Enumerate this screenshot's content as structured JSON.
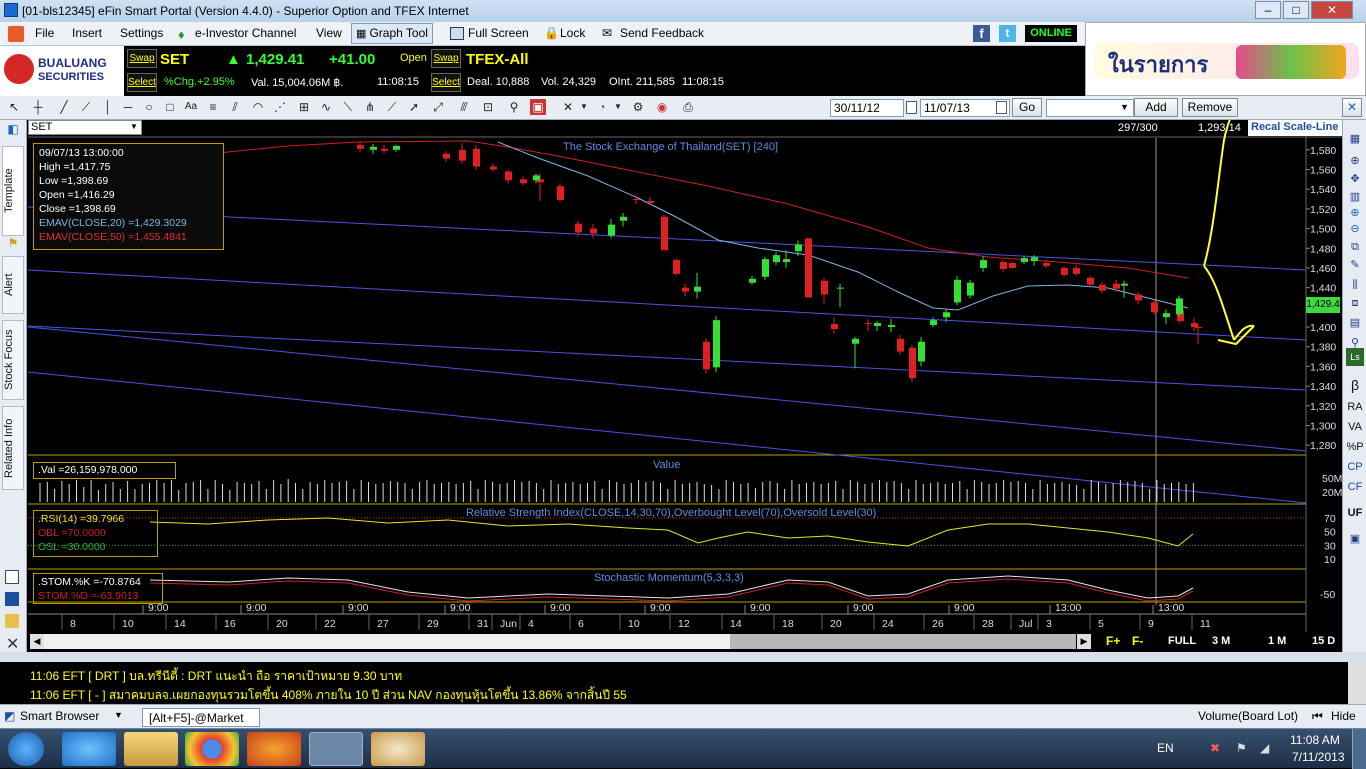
{
  "window": {
    "title": "[01-bls12345] eFin Smart Portal (Version 4.4.0) - Superior Option and TFEX Internet"
  },
  "menu": {
    "items": [
      "File",
      "Insert",
      "Settings",
      "e-Investor Channel",
      "View",
      "Graph Tool",
      "Full Screen",
      "Lock",
      "Send Feedback"
    ],
    "online": "ONLINE"
  },
  "logo": {
    "name1": "BUALUANG",
    "name2": "SECURITIES"
  },
  "quote": {
    "swap": "Swap",
    "select": "Select",
    "set_label": "SET",
    "set_price": "1,429.41",
    "set_change": "+41.00",
    "set_status": "Open",
    "set_pct": "%Chg.+2.95%",
    "set_val": "Val. 15,004.06M ฿.",
    "set_time": "11:08:15",
    "tfex_label": "TFEX-All",
    "tfex_deal": "Deal. 10,888",
    "tfex_vol": "Vol. 24,329",
    "tfex_oint": "OInt. 211,585",
    "tfex_time": "11:08:15"
  },
  "ad": {
    "text": "ในรายการ"
  },
  "drawbar": {
    "date_from": "30/11/12",
    "date_to": "11/07/13",
    "go": "Go",
    "add": "Add",
    "remove": "Remove"
  },
  "lefttabs": [
    "Template",
    "Alert",
    "Stock Focus",
    "Related Info"
  ],
  "chart": {
    "symbol": "SET",
    "title": "The Stock Exchange of Thailand(SET) [240]",
    "counter": "297/300",
    "cursor_value": "1,293.14",
    "recal": "Recal Scale-Line",
    "current_price_label": "1,429.4",
    "info": {
      "date": "09/07/13 13:00:00",
      "high": "High  =1,417.75",
      "low": "Low  =1,398.69",
      "open": "Open  =1,416.29",
      "close": "Close  =1,398.69",
      "ema20": "EMAV(CLOSE,20)  =1,429.3029",
      "ema50": "EMAV(CLOSE,50)  =1,455.4841"
    },
    "val_box": ".Val  =26,159,978.000",
    "value_title": "Value",
    "rsi_title": "Relative Strength Index(CLOSE,14,30,70),Overbought Level(70),Oversold Level(30)",
    "rsi_box": {
      "rsi": ".RSI(14)  =39.7966",
      "obl": "OBL  =70.0000",
      "osl": "OSL  =30.0000"
    },
    "stoch_title": "Stochastic Momentum(5,3,3,3)",
    "stoch_box": {
      "k": ".STOM.%K  =-70.8764",
      "d": "STOM.%D  =-63.9013"
    },
    "time_ticks": [
      "9:00",
      "9:00",
      "9:00",
      "9:00",
      "9:00",
      "9:00",
      "9:00",
      "9:00",
      "9:00",
      "13:00",
      "13:00"
    ],
    "date_ticks": [
      "8",
      "10",
      "14",
      "16",
      "20",
      "22",
      "27",
      "29",
      "31",
      "Jun",
      "4",
      "6",
      "10",
      "12",
      "14",
      "18",
      "20",
      "24",
      "26",
      "28",
      "Jul",
      "3",
      "5",
      "9",
      "11"
    ],
    "price_axis": [
      "1,580",
      "1,560",
      "1,540",
      "1,520",
      "1,500",
      "1,480",
      "1,460",
      "1,440",
      "1,420",
      "1,400",
      "1,380",
      "1,360",
      "1,340",
      "1,320",
      "1,300",
      "1,280"
    ],
    "value_axis": [
      "50M",
      "20M"
    ],
    "rsi_axis": [
      "70",
      "50",
      "30",
      "10"
    ],
    "stoch_axis": [
      "-50"
    ],
    "candles": [
      {
        "o": 1585,
        "h": 1588,
        "l": 1578,
        "c": 1581
      },
      {
        "o": 1580,
        "h": 1586,
        "l": 1576,
        "c": 1583
      },
      {
        "o": 1581,
        "h": 1585,
        "l": 1576,
        "c": 1579
      },
      {
        "o": 1580,
        "h": 1585,
        "l": 1578,
        "c": 1584
      },
      {
        "o": 1576,
        "h": 1579,
        "l": 1568,
        "c": 1571
      },
      {
        "o": 1580,
        "h": 1587,
        "l": 1566,
        "c": 1569
      },
      {
        "o": 1581,
        "h": 1585,
        "l": 1560,
        "c": 1563
      },
      {
        "o": 1563,
        "h": 1566,
        "l": 1558,
        "c": 1560
      },
      {
        "o": 1558,
        "h": 1560,
        "l": 1546,
        "c": 1549
      },
      {
        "o": 1550,
        "h": 1553,
        "l": 1544,
        "c": 1546
      },
      {
        "o": 1550,
        "h": 1556,
        "l": 1528,
        "c": 1547
      },
      {
        "o": 1549,
        "h": 1556,
        "l": 1546,
        "c": 1554
      },
      {
        "o": 1543,
        "h": 1546,
        "l": 1527,
        "c": 1529
      },
      {
        "o": 1505,
        "h": 1508,
        "l": 1492,
        "c": 1496
      },
      {
        "o": 1500,
        "h": 1505,
        "l": 1490,
        "c": 1495
      },
      {
        "o": 1493,
        "h": 1510,
        "l": 1490,
        "c": 1504
      },
      {
        "o": 1508,
        "h": 1516,
        "l": 1502,
        "c": 1512
      },
      {
        "o": 1530,
        "h": 1534,
        "l": 1525,
        "c": 1529
      },
      {
        "o": 1528,
        "h": 1532,
        "l": 1524,
        "c": 1526
      },
      {
        "o": 1512,
        "h": 1514,
        "l": 1490,
        "c": 1478
      },
      {
        "o": 1468,
        "h": 1470,
        "l": 1452,
        "c": 1454
      },
      {
        "o": 1440,
        "h": 1444,
        "l": 1431,
        "c": 1436
      },
      {
        "o": 1436,
        "h": 1455,
        "l": 1429,
        "c": 1441
      },
      {
        "o": 1385,
        "h": 1388,
        "l": 1353,
        "c": 1357
      },
      {
        "o": 1359,
        "h": 1411,
        "l": 1354,
        "c": 1407
      },
      {
        "o": 1445,
        "h": 1452,
        "l": 1443,
        "c": 1449
      },
      {
        "o": 1451,
        "h": 1471,
        "l": 1448,
        "c": 1469
      },
      {
        "o": 1466,
        "h": 1476,
        "l": 1463,
        "c": 1473
      },
      {
        "o": 1466,
        "h": 1478,
        "l": 1460,
        "c": 1469
      },
      {
        "o": 1477,
        "h": 1488,
        "l": 1472,
        "c": 1484
      },
      {
        "o": 1490,
        "h": 1491,
        "l": 1470,
        "c": 1430
      },
      {
        "o": 1447,
        "h": 1450,
        "l": 1424,
        "c": 1433
      },
      {
        "o": 1439,
        "h": 1444,
        "l": 1420,
        "c": 1440
      },
      {
        "o": 1403,
        "h": 1410,
        "l": 1393,
        "c": 1398
      },
      {
        "o": 1404,
        "h": 1408,
        "l": 1396,
        "c": 1403
      },
      {
        "o": 1383,
        "h": 1390,
        "l": 1358,
        "c": 1388
      },
      {
        "o": 1401,
        "h": 1406,
        "l": 1396,
        "c": 1404
      },
      {
        "o": 1400,
        "h": 1408,
        "l": 1395,
        "c": 1402
      },
      {
        "o": 1388,
        "h": 1392,
        "l": 1372,
        "c": 1375
      },
      {
        "o": 1379,
        "h": 1382,
        "l": 1344,
        "c": 1348
      },
      {
        "o": 1365,
        "h": 1390,
        "l": 1360,
        "c": 1385
      },
      {
        "o": 1402,
        "h": 1410,
        "l": 1400,
        "c": 1407
      },
      {
        "o": 1410,
        "h": 1418,
        "l": 1405,
        "c": 1415
      },
      {
        "o": 1425,
        "h": 1452,
        "l": 1422,
        "c": 1448
      },
      {
        "o": 1432,
        "h": 1448,
        "l": 1429,
        "c": 1445
      },
      {
        "o": 1460,
        "h": 1472,
        "l": 1456,
        "c": 1468
      },
      {
        "o": 1466,
        "h": 1468,
        "l": 1456,
        "c": 1459
      },
      {
        "o": 1465,
        "h": 1466,
        "l": 1459,
        "c": 1460
      },
      {
        "o": 1466,
        "h": 1472,
        "l": 1464,
        "c": 1470
      },
      {
        "o": 1467,
        "h": 1473,
        "l": 1462,
        "c": 1471
      },
      {
        "o": 1465,
        "h": 1468,
        "l": 1460,
        "c": 1462
      },
      {
        "o": 1460,
        "h": 1462,
        "l": 1451,
        "c": 1453
      },
      {
        "o": 1460,
        "h": 1463,
        "l": 1452,
        "c": 1454
      },
      {
        "o": 1450,
        "h": 1452,
        "l": 1440,
        "c": 1443
      },
      {
        "o": 1443,
        "h": 1446,
        "l": 1434,
        "c": 1437
      },
      {
        "o": 1444,
        "h": 1448,
        "l": 1436,
        "c": 1439
      },
      {
        "o": 1442,
        "h": 1447,
        "l": 1430,
        "c": 1444
      },
      {
        "o": 1433,
        "h": 1436,
        "l": 1423,
        "c": 1427
      },
      {
        "o": 1425,
        "h": 1428,
        "l": 1413,
        "c": 1415
      },
      {
        "o": 1410,
        "h": 1418,
        "l": 1403,
        "c": 1414
      },
      {
        "o": 1417,
        "h": 1419,
        "l": 1404,
        "c": 1406
      },
      {
        "o": 1404,
        "h": 1409,
        "l": 1396,
        "c": 1400
      },
      {
        "o": 1400,
        "h": 1402,
        "l": 1383,
        "c": 1399
      },
      {
        "o": 1413,
        "h": 1432,
        "l": 1411,
        "c": 1429
      }
    ],
    "volume": [
      19,
      20,
      13,
      21,
      18,
      22,
      15,
      22,
      12,
      18,
      20,
      13,
      21,
      13,
      18,
      19,
      22,
      19,
      22,
      12,
      19,
      20,
      22,
      13,
      22,
      18,
      12,
      20,
      19,
      18,
      21,
      13,
      22,
      18,
      23,
      19,
      13,
      20,
      18,
      22,
      19,
      20,
      21,
      13,
      22,
      20,
      18,
      19,
      21,
      20,
      19,
      13,
      20,
      22,
      18,
      19,
      20,
      18,
      19,
      21,
      13,
      22,
      20,
      18,
      19,
      22,
      20,
      21,
      19,
      13,
      22,
      18,
      19,
      20,
      18,
      19,
      21,
      13,
      22,
      20,
      18,
      19,
      22,
      20,
      21,
      19,
      13,
      22,
      18,
      19,
      20,
      18,
      17,
      13,
      22,
      20,
      18,
      19,
      14,
      20,
      21,
      19,
      13,
      22,
      18,
      19,
      20,
      18,
      19,
      21,
      13,
      22,
      20,
      18,
      19,
      22,
      20,
      21,
      19,
      13,
      22,
      18,
      19,
      20,
      18,
      19,
      21,
      13,
      22,
      20,
      18,
      19,
      22,
      20,
      21,
      19,
      13,
      22,
      18,
      19,
      20,
      18,
      17,
      13,
      22,
      20,
      18,
      19,
      22,
      20,
      21,
      19,
      13,
      22,
      18,
      19,
      20,
      18,
      19,
      21,
      13,
      22,
      20,
      18,
      10,
      22,
      20,
      21,
      19,
      13
    ]
  },
  "status": {
    "full": "FULL",
    "3m": "3 M",
    "1m": "1 M",
    "15d": "15 D"
  },
  "news": [
    "11:06  EFT  [ DRT ]  บล.ทรีนีตี้ : DRT แนะนำ ถือ ราคาเป้าหมาย 9.30 บาท",
    "11:06  EFT  [ - ]  สมาคมบลจ.เผยกองทุนรวมโตขึ้น 408% ภายใน 10 ปี ส่วน NAV กองทุนหุ้นโตขึ้น 13.86% จากสิ้นปี 55"
  ],
  "bottombar": {
    "smart_browser": "Smart Browser",
    "market_tab": "[Alt+F5]-@Market",
    "volume_mode": "Volume(Board Lot)",
    "hide": "Hide"
  },
  "taskbar": {
    "lang": "EN",
    "time": "11:08 AM",
    "date": "7/11/2013"
  }
}
